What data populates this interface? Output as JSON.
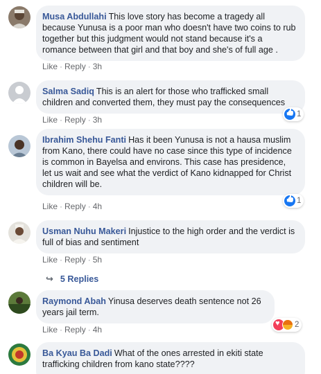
{
  "colors": {
    "link": "#385898",
    "bubble": "#f0f2f5",
    "meta": "#65676b"
  },
  "comments": [
    {
      "author": "Musa Abdullahi",
      "text": "This love story has become a tragedy all because Yunusa is a poor man who doesn't have two coins to rub together but this judgment would not stand because it's a romance between that girl and that boy and she's of full age .",
      "like": "Like",
      "reply": "Reply",
      "time": "3h"
    },
    {
      "author": "Salma Sadiq",
      "text": "This is an alert for those who trafficked small children and converted them, they must pay the consequences",
      "like": "Like",
      "reply": "Reply",
      "time": "3h",
      "reactions": {
        "icons": [
          "like-icon"
        ],
        "count": "1"
      }
    },
    {
      "author": "Ibrahim Shehu Fanti",
      "text": "Has it been Yunusa is not a hausa muslim from Kano, there could have no case since this type of incidence is common in Bayelsa and environs. This case has presidence, let us wait and see what the verdict of Kano kidnapped for Christ children will be.",
      "like": "Like",
      "reply": "Reply",
      "time": "4h",
      "reactions": {
        "icons": [
          "like-icon"
        ],
        "count": "1"
      }
    },
    {
      "author": "Usman Nuhu Makeri",
      "text": "Injustice to the high order and the verdict is full of bias and sentiment",
      "like": "Like",
      "reply": "Reply",
      "time": "5h",
      "replies": "5 Replies"
    },
    {
      "author": "Raymond Abah",
      "text": "Yinusa deserves death sentence not 26 years jail term.",
      "like": "Like",
      "reply": "Reply",
      "time": "4h",
      "reactions": {
        "icons": [
          "love-icon",
          "angry-icon"
        ],
        "count": "2"
      }
    },
    {
      "author": "Ba Kyau Ba Dadi",
      "text": "What of the ones arrested in ekiti state trafficking children from kano state????"
    }
  ]
}
